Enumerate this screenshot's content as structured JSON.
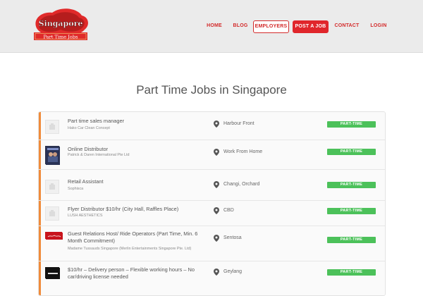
{
  "header": {
    "logo_top": "Singapore",
    "logo_bottom": "Part Time Jobs",
    "nav": [
      {
        "label": "HOME"
      },
      {
        "label": "BLOG"
      },
      {
        "label": "EMPLOYERS"
      },
      {
        "label": "POST A JOB"
      },
      {
        "label": "CONTACT"
      },
      {
        "label": "LOGIN"
      }
    ]
  },
  "page": {
    "title": "Part Time Jobs in Singapore"
  },
  "jobs": [
    {
      "title": "Part time sales manager",
      "company": "Hako Car Clean Concept",
      "location": "Harbour Front",
      "type": "PART-TIME",
      "logo": "placeholder-icon"
    },
    {
      "title": "Online Distributor",
      "company": "Patrick & Daren International Pte Ltd",
      "location": "Work From Home",
      "type": "PART-TIME",
      "logo": "company-logo"
    },
    {
      "title": "Retail Assistant",
      "company": "Sophisca",
      "location": "Changi, Orchard",
      "type": "PART-TIME",
      "logo": "placeholder-icon"
    },
    {
      "title": "Flyer Distributor $10/hr (City Hall, Raffles Place)",
      "company": "LUSH AESTHETICS",
      "location": "CBD",
      "type": "PART-TIME",
      "logo": "placeholder-icon"
    },
    {
      "title": "Guest Relations Host/ Ride Operators (Part Time, Min. 6 Month Commitment)",
      "company": "Madame Tussauds Singapore (Merlin Entertainments Singapore Pte. Ltd)",
      "location": "Sentosa",
      "type": "PART-TIME",
      "logo": "madame-tussauds-logo"
    },
    {
      "title": "$10/hr – Delivery person – Flexible working hours – No car/driving license needed",
      "company": "",
      "location": "Geylang",
      "type": "PART-TIME",
      "logo": "company-logo"
    }
  ],
  "colors": {
    "brand_red": "#d32a2a",
    "accent_orange": "#f08b3a",
    "badge_green": "#4cc15a"
  }
}
